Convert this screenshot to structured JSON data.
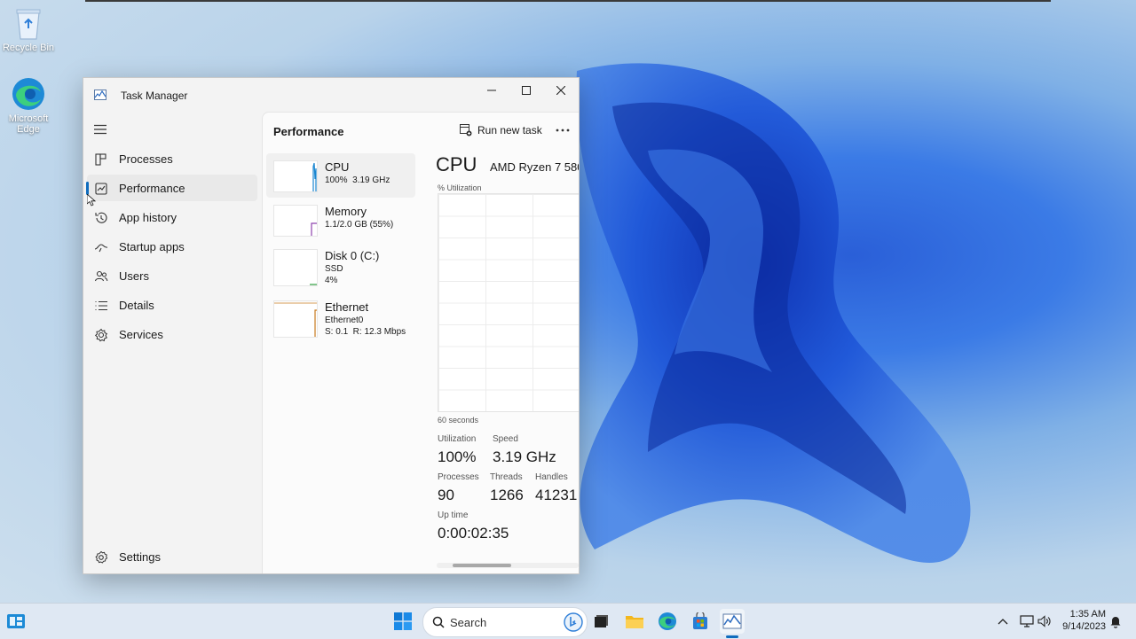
{
  "desktop": {
    "icons": [
      {
        "label": "Recycle Bin"
      },
      {
        "label": "Microsoft Edge"
      }
    ]
  },
  "window": {
    "title": "Task Manager",
    "controls": {
      "minimize": "minimize-icon",
      "maximize": "maximize-icon",
      "close": "close-icon"
    }
  },
  "sidebar": {
    "items": [
      {
        "label": "Processes",
        "icon": "processes-icon"
      },
      {
        "label": "Performance",
        "icon": "performance-icon",
        "active": true
      },
      {
        "label": "App history",
        "icon": "app-history-icon"
      },
      {
        "label": "Startup apps",
        "icon": "startup-apps-icon"
      },
      {
        "label": "Users",
        "icon": "users-icon"
      },
      {
        "label": "Details",
        "icon": "details-icon"
      },
      {
        "label": "Services",
        "icon": "services-icon"
      }
    ],
    "settings_label": "Settings"
  },
  "content": {
    "page_title": "Performance",
    "run_new_task": "Run new task",
    "resources": [
      {
        "name": "CPU",
        "line1": "100%  3.19 GHz",
        "line2": "",
        "color": "#1a86d0"
      },
      {
        "name": "Memory",
        "line1": "1.1/2.0 GB (55%)",
        "line2": "",
        "color": "#8e44ad"
      },
      {
        "name": "Disk 0 (C:)",
        "line1": "SSD",
        "line2": "4%",
        "color": "#2e9e3e"
      },
      {
        "name": "Ethernet",
        "line1": "Ethernet0",
        "line2": "S: 0.1  R: 12.3 Mbps",
        "color": "#c97a1e"
      }
    ],
    "detail": {
      "title": "CPU",
      "model": "AMD Ryzen 7 580",
      "graph_label": "% Utilization",
      "time_label": "60 seconds",
      "stats": {
        "utilization_label": "Utilization",
        "utilization": "100%",
        "speed_label": "Speed",
        "speed": "3.19 GHz",
        "processes_label": "Processes",
        "processes": "90",
        "threads_label": "Threads",
        "threads": "1266",
        "handles_label": "Handles",
        "handles": "41231",
        "uptime_label": "Up time",
        "uptime": "0:00:02:35"
      }
    }
  },
  "taskbar": {
    "search_placeholder": "Search",
    "time": "1:35 AM",
    "date": "9/14/2023"
  },
  "colors": {
    "accent": "#0f6cbd",
    "window_bg": "#f3f3f3",
    "taskbar_bg": "#dfe8f3"
  }
}
